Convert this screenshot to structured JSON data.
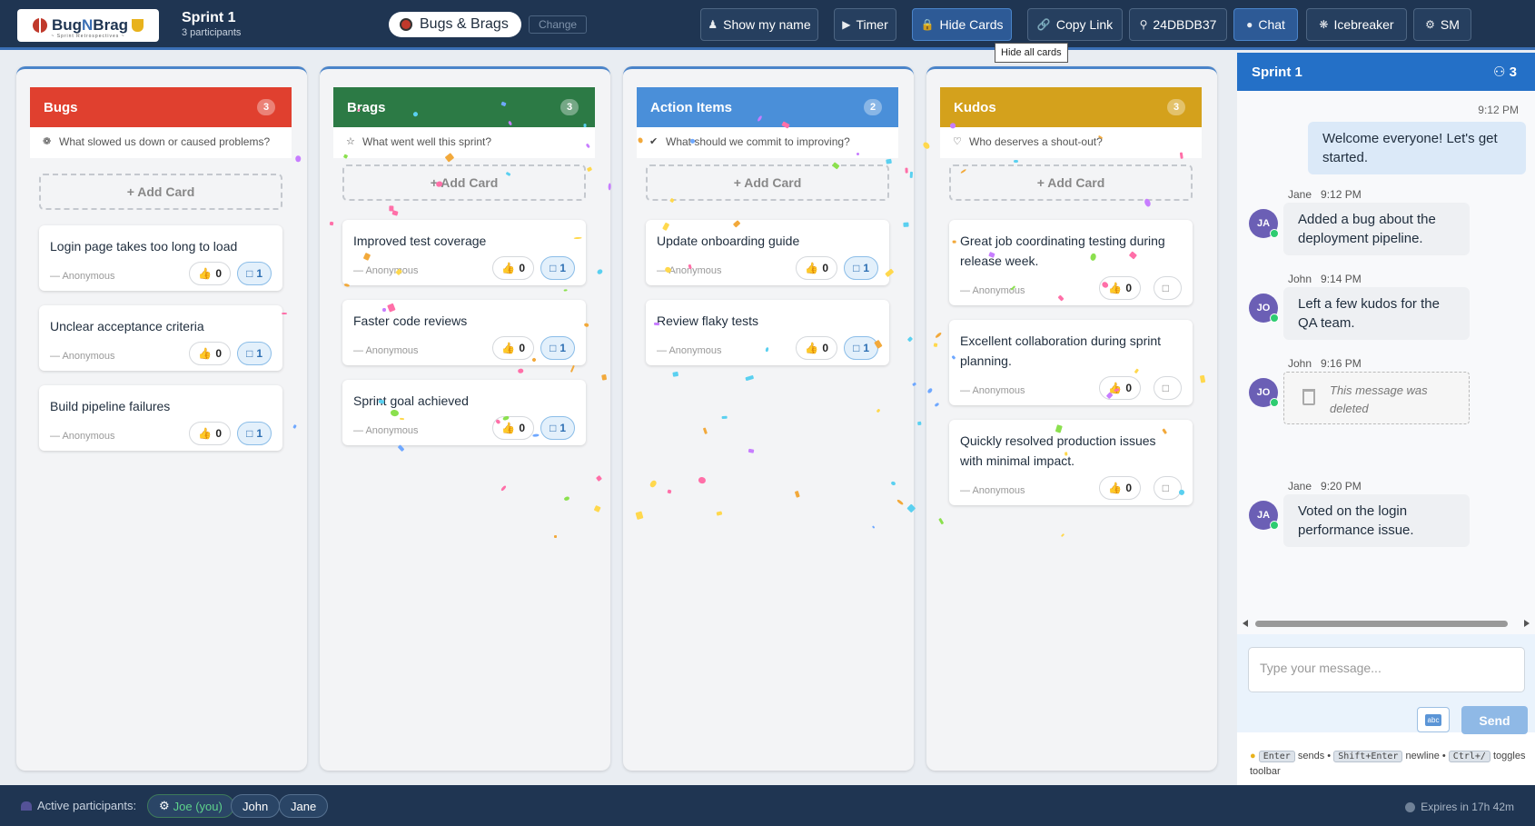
{
  "header": {
    "logo_text_a": "Bug",
    "logo_text_n": "N",
    "logo_text_b": "Brag",
    "logo_tagline": "~ Sprint Retrospectives ~",
    "sprint_title": "Sprint 1",
    "participants_text": "3 participants",
    "template_label": "Bugs & Brags",
    "change_label": "Change",
    "buttons": {
      "show_name": "Show my name",
      "timer": "Timer",
      "hide_cards": "Hide Cards",
      "copy_link": "Copy Link",
      "room_code": "24DBDB37",
      "chat": "Chat",
      "icebreaker": "Icebreaker",
      "sm": "SM"
    },
    "tooltip": "Hide all cards"
  },
  "columns": [
    {
      "title": "Bugs",
      "count": "3",
      "color": "#e0402f",
      "description": "What slowed us down or caused problems?",
      "add_label": "+ Add Card",
      "cards": [
        {
          "text": "Login page takes too long to load",
          "author": "— Anonymous",
          "votes": "0",
          "comments": "1"
        },
        {
          "text": "Unclear acceptance criteria",
          "author": "— Anonymous",
          "votes": "0",
          "comments": "1"
        },
        {
          "text": "Build pipeline failures",
          "author": "— Anonymous",
          "votes": "0",
          "comments": "1"
        }
      ]
    },
    {
      "title": "Brags",
      "count": "3",
      "color": "#2c7a45",
      "description": "What went well this sprint?",
      "add_label": "+ Add Card",
      "cards": [
        {
          "text": "Improved test coverage",
          "author": "— Anonymous",
          "votes": "0",
          "comments": "1"
        },
        {
          "text": "Faster code reviews",
          "author": "— Anonymous",
          "votes": "0",
          "comments": "1"
        },
        {
          "text": "Sprint goal achieved",
          "author": "— Anonymous",
          "votes": "0",
          "comments": "1"
        }
      ]
    },
    {
      "title": "Action Items",
      "count": "2",
      "color": "#4a8fd9",
      "description": "What should we commit to improving?",
      "add_label": "+ Add Card",
      "cards": [
        {
          "text": "Update onboarding guide",
          "author": "— Anonymous",
          "votes": "0",
          "comments": "1"
        },
        {
          "text": "Review flaky tests",
          "author": "— Anonymous",
          "votes": "0",
          "comments": "1"
        }
      ]
    },
    {
      "title": "Kudos",
      "count": "3",
      "color": "#d4a11c",
      "description": "Who deserves a shout-out?",
      "add_label": "+ Add Card",
      "cards": [
        {
          "text": "Great job coordinating testing during release week.",
          "author": "— Anonymous",
          "votes": "0",
          "comments": ""
        },
        {
          "text": "Excellent collaboration during sprint planning.",
          "author": "— Anonymous",
          "votes": "0",
          "comments": ""
        },
        {
          "text": "Quickly resolved production issues with minimal impact.",
          "author": "— Anonymous",
          "votes": "0",
          "comments": ""
        }
      ]
    }
  ],
  "chat": {
    "title": "Sprint 1",
    "participant_count": "3",
    "messages": [
      {
        "self": true,
        "time": "9:12 PM",
        "text": "Welcome everyone! Let's get started."
      },
      {
        "author": "Jane",
        "initials": "JA",
        "time": "9:12 PM",
        "text": "Added a bug about the deployment pipeline."
      },
      {
        "author": "John",
        "initials": "JO",
        "time": "9:14 PM",
        "text": "Left a few kudos for the QA team."
      },
      {
        "author": "John",
        "initials": "JO",
        "time": "9:16 PM",
        "deleted": true,
        "text": "This message was deleted"
      },
      {
        "author": "Jane",
        "initials": "JA",
        "time": "9:20 PM",
        "text": "Voted on the login performance issue."
      }
    ],
    "input_placeholder": "Type your message...",
    "abc_label": "abc",
    "send_label": "Send",
    "hint": {
      "k1": "Enter",
      "t1": "sends •",
      "k2": "Shift+Enter",
      "t2": "newline •",
      "k3": "Ctrl+/",
      "t3": "toggles toolbar"
    }
  },
  "footer": {
    "active_label": "Active participants:",
    "participants": [
      "Joe (you)",
      "John",
      "Jane"
    ],
    "expires": "Expires in 17h 42m"
  }
}
